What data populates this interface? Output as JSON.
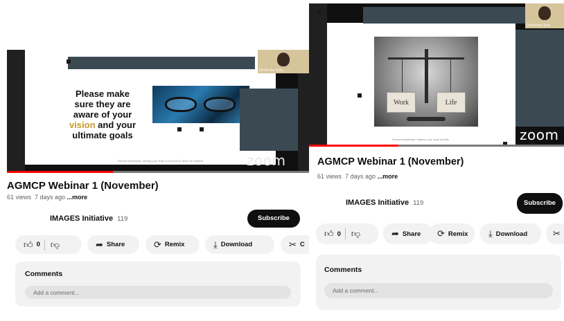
{
  "video": {
    "title": "AGMCP Webinar 1 (November)",
    "views": "61 views",
    "age": "7 days ago",
    "more": "...more",
    "progress_fraction": 0.35
  },
  "slide_left": {
    "line1": "Please make",
    "line2": "sure they are",
    "line3": "aware of your",
    "accent": "vision",
    "line4_rest": " and your",
    "line5": "ultimate goals",
    "footnote": "Servant leadership: serving your team to succeed & thrive for balance"
  },
  "slide_right": {
    "pan_left": "Work",
    "pan_right": "Life",
    "footnote": "Servant leadership: balance your work and life"
  },
  "zoom_logo": "zoom",
  "camera": {
    "name": "Olufunke Sub..."
  },
  "channel": {
    "name": "IMAGES Initiative",
    "subscribers": "119",
    "subscribe_label": "Subscribe"
  },
  "actions": {
    "likes": "0",
    "share": "Share",
    "remix": "Remix",
    "download": "Download",
    "clip_left": "C"
  },
  "comments": {
    "title": "Comments",
    "placeholder": "Add a comment..."
  },
  "icons": {
    "like": "thumb-up-icon",
    "dislike": "thumb-down-icon",
    "share": "share-arrow-icon",
    "remix": "remix-icon",
    "download": "download-icon",
    "clip": "scissors-icon"
  },
  "colors": {
    "progress": "#ff0000",
    "subscribe_bg": "#0f0f0f",
    "pill_bg": "#f2f2f2"
  }
}
